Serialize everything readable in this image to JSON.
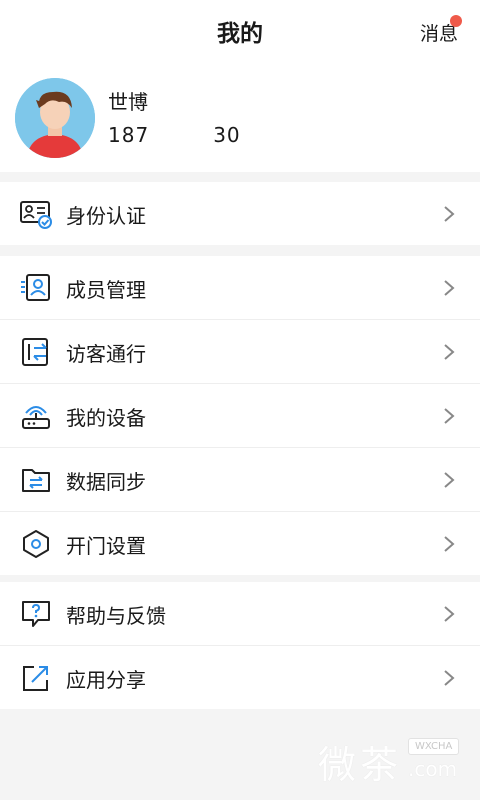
{
  "header": {
    "title": "我的",
    "message_label": "消息"
  },
  "profile": {
    "name": "世博",
    "phone_prefix": "187",
    "phone_suffix": "30"
  },
  "colors": {
    "accent": "#2b8ce6",
    "badge": "#ef5a4a",
    "avatar_bg": "#7ec7ea"
  },
  "groups": [
    {
      "items": [
        {
          "label": "身份认证",
          "icon": "id-card-icon"
        }
      ]
    },
    {
      "items": [
        {
          "label": "成员管理",
          "icon": "member-icon"
        },
        {
          "label": "访客通行",
          "icon": "visitor-icon"
        },
        {
          "label": "我的设备",
          "icon": "device-icon"
        },
        {
          "label": "数据同步",
          "icon": "sync-folder-icon"
        },
        {
          "label": "开门设置",
          "icon": "hexagon-settings-icon"
        }
      ]
    },
    {
      "items": [
        {
          "label": "帮助与反馈",
          "icon": "help-icon"
        },
        {
          "label": "应用分享",
          "icon": "share-icon"
        }
      ]
    }
  ],
  "watermark": {
    "text": "微茶",
    "badge": "WXCHA",
    "domain": ".com"
  }
}
